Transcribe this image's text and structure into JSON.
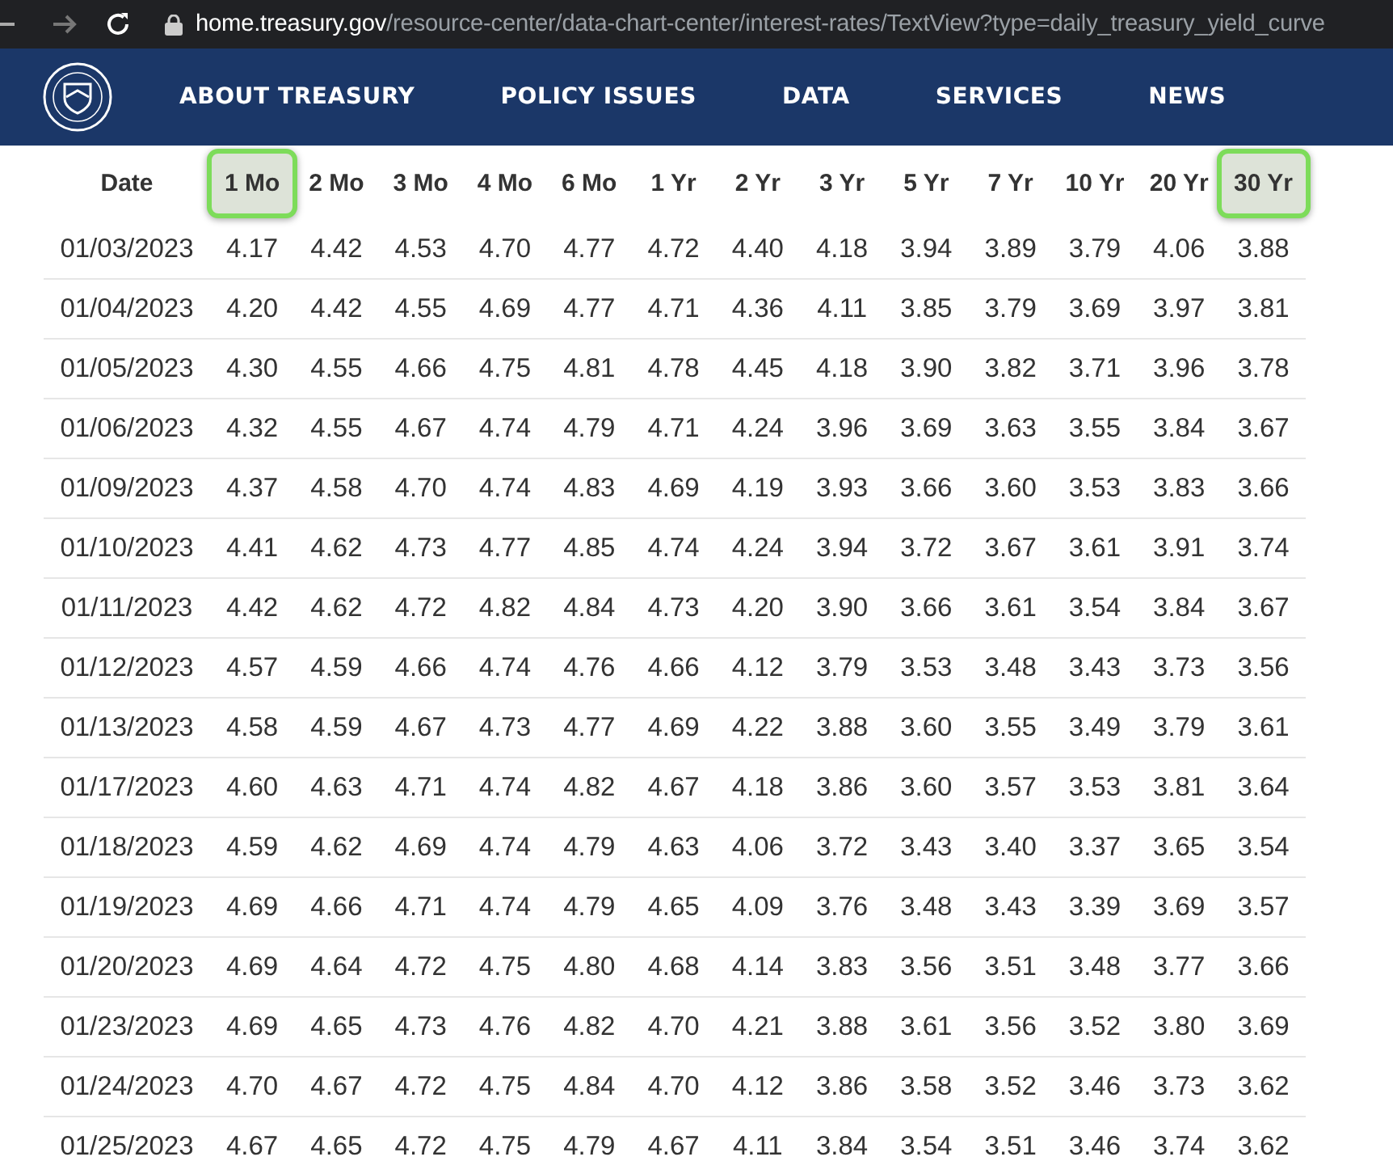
{
  "address_bar": {
    "host": "home.treasury.gov",
    "path": "/resource-center/data-chart-center/interest-rates/TextView?type=daily_treasury_yield_curve"
  },
  "nav": {
    "items": [
      "ABOUT TREASURY",
      "POLICY ISSUES",
      "DATA",
      "SERVICES",
      "NEWS"
    ]
  },
  "table": {
    "columns": [
      {
        "label": "Date",
        "selected": false
      },
      {
        "label": "1 Mo",
        "selected": true
      },
      {
        "label": "2 Mo",
        "selected": false
      },
      {
        "label": "3 Mo",
        "selected": false
      },
      {
        "label": "4 Mo",
        "selected": false
      },
      {
        "label": "6 Mo",
        "selected": false
      },
      {
        "label": "1 Yr",
        "selected": false
      },
      {
        "label": "2 Yr",
        "selected": false
      },
      {
        "label": "3 Yr",
        "selected": false
      },
      {
        "label": "5 Yr",
        "selected": false
      },
      {
        "label": "7 Yr",
        "selected": false
      },
      {
        "label": "10 Yr",
        "selected": false
      },
      {
        "label": "20 Yr",
        "selected": false
      },
      {
        "label": "30 Yr",
        "selected": true
      }
    ],
    "rows": [
      [
        "01/03/2023",
        "4.17",
        "4.42",
        "4.53",
        "4.70",
        "4.77",
        "4.72",
        "4.40",
        "4.18",
        "3.94",
        "3.89",
        "3.79",
        "4.06",
        "3.88"
      ],
      [
        "01/04/2023",
        "4.20",
        "4.42",
        "4.55",
        "4.69",
        "4.77",
        "4.71",
        "4.36",
        "4.11",
        "3.85",
        "3.79",
        "3.69",
        "3.97",
        "3.81"
      ],
      [
        "01/05/2023",
        "4.30",
        "4.55",
        "4.66",
        "4.75",
        "4.81",
        "4.78",
        "4.45",
        "4.18",
        "3.90",
        "3.82",
        "3.71",
        "3.96",
        "3.78"
      ],
      [
        "01/06/2023",
        "4.32",
        "4.55",
        "4.67",
        "4.74",
        "4.79",
        "4.71",
        "4.24",
        "3.96",
        "3.69",
        "3.63",
        "3.55",
        "3.84",
        "3.67"
      ],
      [
        "01/09/2023",
        "4.37",
        "4.58",
        "4.70",
        "4.74",
        "4.83",
        "4.69",
        "4.19",
        "3.93",
        "3.66",
        "3.60",
        "3.53",
        "3.83",
        "3.66"
      ],
      [
        "01/10/2023",
        "4.41",
        "4.62",
        "4.73",
        "4.77",
        "4.85",
        "4.74",
        "4.24",
        "3.94",
        "3.72",
        "3.67",
        "3.61",
        "3.91",
        "3.74"
      ],
      [
        "01/11/2023",
        "4.42",
        "4.62",
        "4.72",
        "4.82",
        "4.84",
        "4.73",
        "4.20",
        "3.90",
        "3.66",
        "3.61",
        "3.54",
        "3.84",
        "3.67"
      ],
      [
        "01/12/2023",
        "4.57",
        "4.59",
        "4.66",
        "4.74",
        "4.76",
        "4.66",
        "4.12",
        "3.79",
        "3.53",
        "3.48",
        "3.43",
        "3.73",
        "3.56"
      ],
      [
        "01/13/2023",
        "4.58",
        "4.59",
        "4.67",
        "4.73",
        "4.77",
        "4.69",
        "4.22",
        "3.88",
        "3.60",
        "3.55",
        "3.49",
        "3.79",
        "3.61"
      ],
      [
        "01/17/2023",
        "4.60",
        "4.63",
        "4.71",
        "4.74",
        "4.82",
        "4.67",
        "4.18",
        "3.86",
        "3.60",
        "3.57",
        "3.53",
        "3.81",
        "3.64"
      ],
      [
        "01/18/2023",
        "4.59",
        "4.62",
        "4.69",
        "4.74",
        "4.79",
        "4.63",
        "4.06",
        "3.72",
        "3.43",
        "3.40",
        "3.37",
        "3.65",
        "3.54"
      ],
      [
        "01/19/2023",
        "4.69",
        "4.66",
        "4.71",
        "4.74",
        "4.79",
        "4.65",
        "4.09",
        "3.76",
        "3.48",
        "3.43",
        "3.39",
        "3.69",
        "3.57"
      ],
      [
        "01/20/2023",
        "4.69",
        "4.64",
        "4.72",
        "4.75",
        "4.80",
        "4.68",
        "4.14",
        "3.83",
        "3.56",
        "3.51",
        "3.48",
        "3.77",
        "3.66"
      ],
      [
        "01/23/2023",
        "4.69",
        "4.65",
        "4.73",
        "4.76",
        "4.82",
        "4.70",
        "4.21",
        "3.88",
        "3.61",
        "3.56",
        "3.52",
        "3.80",
        "3.69"
      ],
      [
        "01/24/2023",
        "4.70",
        "4.67",
        "4.72",
        "4.75",
        "4.84",
        "4.70",
        "4.12",
        "3.86",
        "3.58",
        "3.52",
        "3.46",
        "3.73",
        "3.62"
      ],
      [
        "01/25/2023",
        "4.67",
        "4.65",
        "4.72",
        "4.75",
        "4.79",
        "4.67",
        "4.11",
        "3.84",
        "3.54",
        "3.51",
        "3.46",
        "3.74",
        "3.62"
      ]
    ]
  }
}
